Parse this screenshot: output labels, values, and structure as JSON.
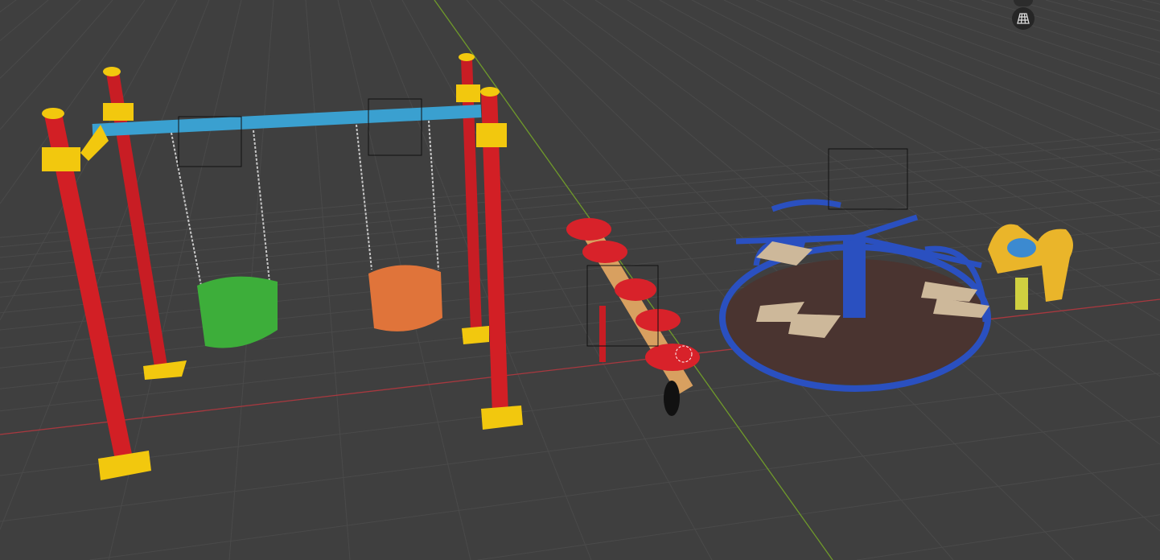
{
  "viewport": {
    "background_color": "#3f3f3f",
    "grid_color": "#4a4a4a",
    "x_axis_color": "#a8383f",
    "y_axis_color": "#6f9a2a"
  },
  "overlay_buttons": [
    {
      "icon": "navigation-gizmo-icon"
    },
    {
      "icon": "perspective-grid-icon"
    }
  ],
  "objects": [
    {
      "name": "swing-set",
      "colors": {
        "post": "#d21f25",
        "beam": "#3aa0d0",
        "bracket": "#f2c80e"
      }
    },
    {
      "name": "swing-seat-green",
      "color": "#3dae3a"
    },
    {
      "name": "swing-seat-orange",
      "color": "#e0743a"
    },
    {
      "name": "seesaw",
      "colors": {
        "seat": "#d8222a",
        "log": "#d8a060"
      }
    },
    {
      "name": "merry-go-round",
      "colors": {
        "frame": "#2a50c0",
        "base": "#4a3430",
        "seat": "#cdb89a"
      }
    },
    {
      "name": "spring-rider",
      "colors": {
        "body": "#eab52a",
        "seat": "#3c8ad0"
      }
    }
  ]
}
